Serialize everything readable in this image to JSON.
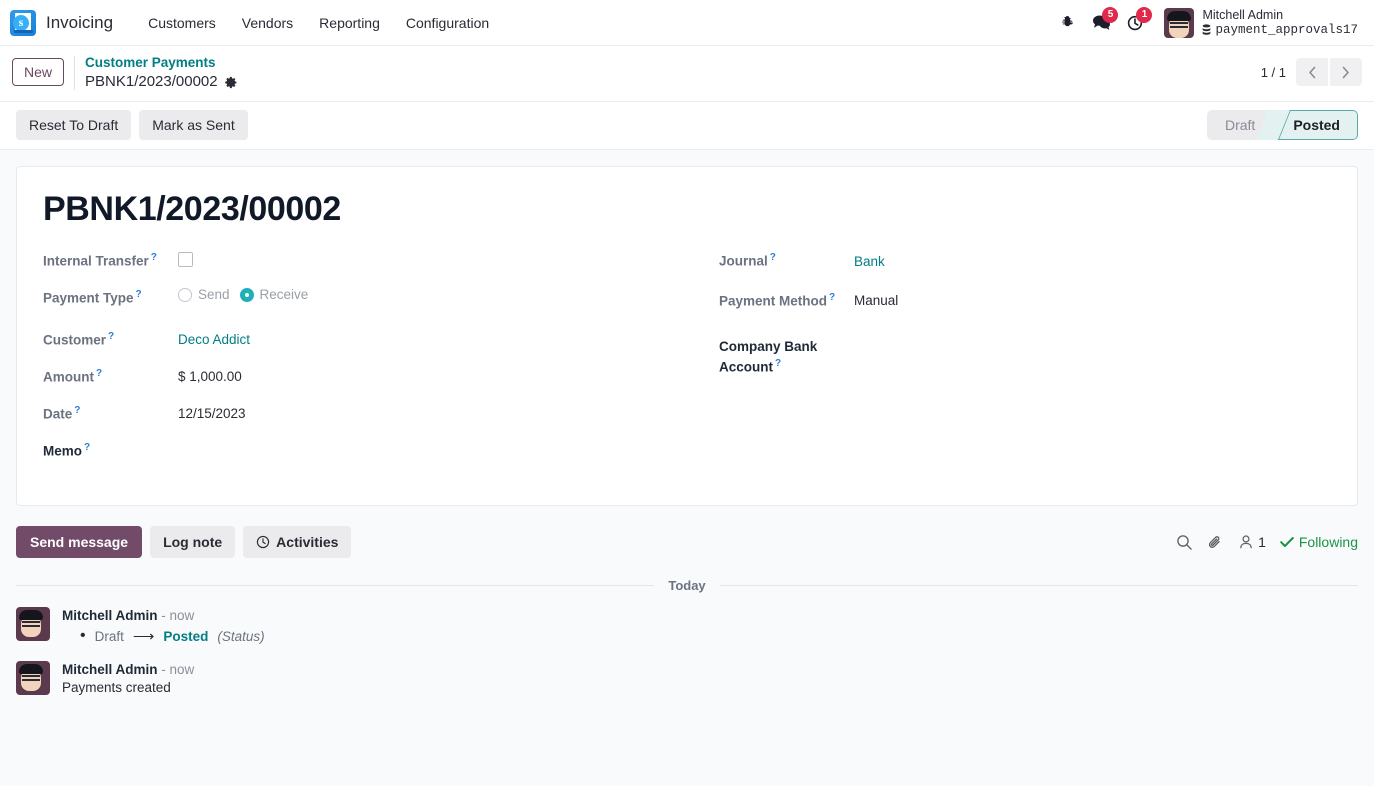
{
  "navbar": {
    "brand": "Invoicing",
    "menus": [
      {
        "label": "Customers"
      },
      {
        "label": "Vendors"
      },
      {
        "label": "Reporting"
      },
      {
        "label": "Configuration"
      }
    ],
    "icons": {
      "debug": "bug-icon",
      "messages": "messages-icon",
      "activities": "clock-icon"
    },
    "messages_badge": "5",
    "activities_badge": "1",
    "user_name": "Mitchell Admin",
    "user_database": "payment_approvals17"
  },
  "control_panel": {
    "new_label": "New",
    "breadcrumb_parent": "Customer Payments",
    "breadcrumb_current": "PBNK1/2023/00002",
    "pager_text": "1 / 1",
    "prev_label": "‹",
    "next_label": "›"
  },
  "statusbar": {
    "buttons": [
      {
        "label": "Reset To Draft"
      },
      {
        "label": "Mark as Sent"
      }
    ],
    "stages": [
      {
        "label": "Draft",
        "active": false
      },
      {
        "label": "Posted",
        "active": true
      }
    ]
  },
  "form": {
    "title": "PBNK1/2023/00002",
    "left": {
      "internal_transfer_label": "Internal Transfer",
      "internal_transfer_checked": false,
      "payment_type_label": "Payment Type",
      "payment_type_options": [
        "Send",
        "Receive"
      ],
      "payment_type_selected": "Receive",
      "customer_label": "Customer",
      "customer_value": "Deco Addict",
      "amount_label": "Amount",
      "amount_value": "$ 1,000.00",
      "date_label": "Date",
      "date_value": "12/15/2023",
      "memo_label": "Memo",
      "memo_value": ""
    },
    "right": {
      "journal_label": "Journal",
      "journal_value": "Bank",
      "payment_method_label": "Payment Method",
      "payment_method_value": "Manual",
      "company_bank_account_label": "Company Bank Account",
      "company_bank_account_value": ""
    }
  },
  "chatter": {
    "send_message_label": "Send message",
    "log_note_label": "Log note",
    "activities_label": "Activities",
    "followers_count": "1",
    "following_label": "Following",
    "date_separator": "Today",
    "messages": [
      {
        "author": "Mitchell Admin",
        "time": "- now",
        "tracking": {
          "old_value": "Draft",
          "arrow": "⟶",
          "new_value": "Posted",
          "field": "(Status)"
        },
        "body": ""
      },
      {
        "author": "Mitchell Admin",
        "time": "- now",
        "body": "Payments created"
      }
    ]
  },
  "colors": {
    "brand_purple": "#714b67",
    "link_teal": "#017e84",
    "badge_red": "#e0294b",
    "following_green": "#1a9447",
    "accent_cyan": "#1fb0b8"
  }
}
